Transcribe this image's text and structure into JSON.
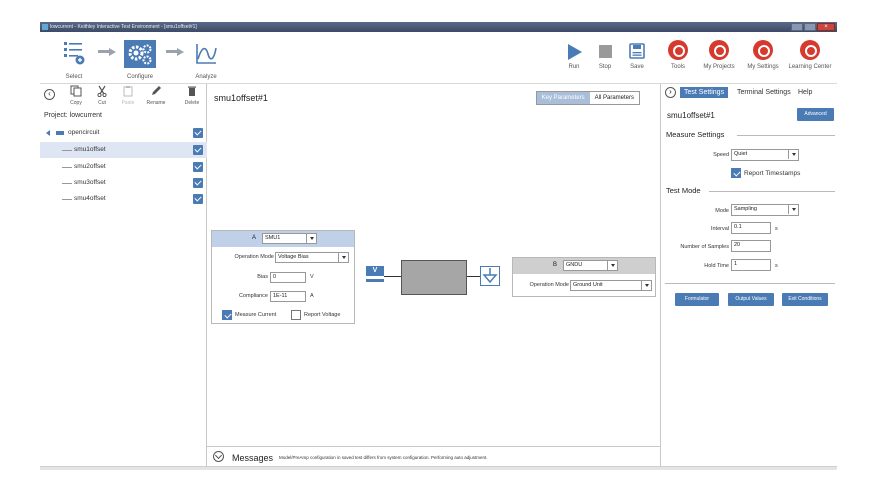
{
  "window": {
    "title": "lowcurrent - Keithley Interactive Test Environment - [smu1offset#1]"
  },
  "toolbar": {
    "select_label": "Select",
    "configure_label": "Configure",
    "analyze_label": "Analyze",
    "run_label": "Run",
    "stop_label": "Stop",
    "save_label": "Save",
    "tools_label": "Tools",
    "my_projects_label": "My Projects",
    "my_settings_label": "My Settings",
    "learning_center_label": "Learning Center"
  },
  "project_tools": {
    "copy_label": "Copy",
    "cut_label": "Cut",
    "paste_label": "Paste",
    "rename_label": "Rename",
    "delete_label": "Delete"
  },
  "project": {
    "label": "Project: lowcurrent",
    "device": "opencircuit",
    "tests": [
      {
        "name": "smu1offset",
        "selected": true
      },
      {
        "name": "smu2offset",
        "selected": false
      },
      {
        "name": "smu3offset",
        "selected": false
      },
      {
        "name": "smu4offset",
        "selected": false
      }
    ]
  },
  "center": {
    "title": "smu1offset#1",
    "key_params_label": "Key Parameters",
    "all_params_label": "All Parameters"
  },
  "terminal_a": {
    "letter": "A",
    "instrument": "SMU1",
    "op_mode_label": "Operation Mode",
    "op_mode": "Voltage Bias",
    "bias_label": "Bias",
    "bias": "0",
    "bias_unit": "V",
    "compliance_label": "Compliance",
    "compliance": "1E-11",
    "compliance_unit": "A",
    "measure_current_label": "Measure Current",
    "report_voltage_label": "Report Voltage",
    "source_symbol": "V"
  },
  "terminal_b": {
    "letter": "B",
    "instrument": "GNDU",
    "op_mode_label": "Operation Mode",
    "op_mode": "Ground Unit"
  },
  "messages": {
    "title": "Messages",
    "text": "Model/PreAmp configuration in saved test differs from system configuration. Performing auto adjustment."
  },
  "right": {
    "tab_test_settings": "Test Settings",
    "tab_terminal_settings": "Terminal Settings",
    "tab_help": "Help",
    "test_name": "smu1offset#1",
    "advanced_label": "Advanced",
    "measure_settings_title": "Measure Settings",
    "speed_label": "Speed",
    "speed": "Quiet",
    "report_timestamps_label": "Report Timestamps",
    "test_mode_title": "Test Mode",
    "mode_label": "Mode",
    "mode": "Sampling",
    "interval_label": "Interval",
    "interval": "0.1",
    "interval_unit": "s",
    "samples_label": "Number of Samples",
    "samples": "20",
    "hold_label": "Hold Time",
    "hold": "1",
    "hold_unit": "s",
    "formulator_label": "Formulator",
    "output_values_label": "Output Values",
    "exit_conditions_label": "Exit Conditions"
  },
  "colors": {
    "accent": "#4b7bb5",
    "red": "#d63a2e",
    "header_blue": "#bfd0e8"
  }
}
